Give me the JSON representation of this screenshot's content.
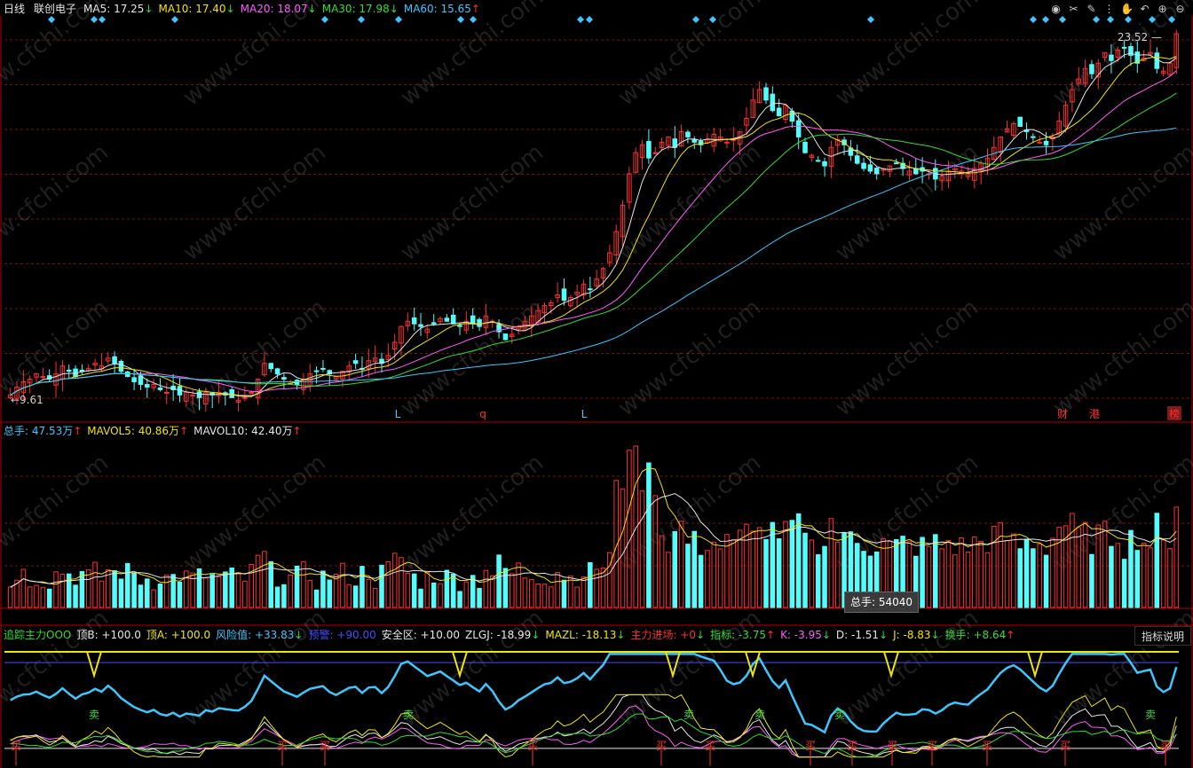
{
  "header": {
    "period": "日线",
    "stock_name": "联创电子",
    "ma": [
      {
        "label": "MA5: 17.25",
        "arrow": "↓",
        "color": "#e6e6e6"
      },
      {
        "label": "MA10: 17.40",
        "arrow": "↓",
        "color": "#f2e600"
      },
      {
        "label": "MA20: 18.07",
        "arrow": "↓",
        "color": "#ff5cff"
      },
      {
        "label": "MA30: 17.98",
        "arrow": "↓",
        "color": "#33dd33"
      },
      {
        "label": "MA60: 15.65",
        "arrow": "↑",
        "color": "#3cc8ff"
      }
    ]
  },
  "toolbar": {
    "icons": [
      "eye-icon",
      "scissors-icon",
      "draw-icon",
      "signal-icon",
      "hand-icon",
      "back-icon",
      "zoom-in-icon",
      "zoom-out-icon"
    ],
    "glyphs": [
      "◉",
      "✂",
      "✎",
      "⋮",
      "✋",
      "↶",
      "⊕",
      "⊖"
    ]
  },
  "price_panel": {
    "high_label": "23.52",
    "low_label": "9.61",
    "marks": [
      {
        "text": "L",
        "color": "#3cc8ff"
      },
      {
        "text": "q",
        "color": "#ff3030"
      },
      {
        "text": "L",
        "color": "#3cc8ff"
      },
      {
        "text": "财",
        "color": "#ff3030"
      },
      {
        "text": "港",
        "color": "#ff3030"
      },
      {
        "text": "榜",
        "color": "#ff3030"
      }
    ]
  },
  "volume_panel": {
    "legend": [
      {
        "label": "总手: 47.53万",
        "arrow": "↑",
        "color": "#3cc8ff"
      },
      {
        "label": "MAVOL5: 40.86万",
        "arrow": "↑",
        "color": "#f2e600"
      },
      {
        "label": "MAVOL10: 42.40万",
        "arrow": "↑",
        "color": "#e6e6e6"
      }
    ],
    "tooltip": "总手: 54040"
  },
  "indicator_panel": {
    "legend": [
      {
        "label": "追踪主力OOO",
        "color": "#33dd33"
      },
      {
        "label": "顶B: +100.0",
        "color": "#e6e6e6"
      },
      {
        "label": "顶A: +100.0",
        "color": "#f2e600"
      },
      {
        "label": "风险值: +33.83",
        "arrow": "↓",
        "color": "#3cc8ff"
      },
      {
        "label": "预警: +90.00",
        "color": "#4a4aff"
      },
      {
        "label": "安全区: +10.00",
        "color": "#e6e6e6"
      },
      {
        "label": "ZLGJ: -18.99",
        "arrow": "↓",
        "color": "#e6e6e6"
      },
      {
        "label": "MAZL: -18.13",
        "arrow": "↓",
        "color": "#f2e600"
      },
      {
        "label": "主力进场: +0",
        "arrow": "↓",
        "color": "#ff3030"
      },
      {
        "label": "指标: -3.75",
        "arrow": "↑",
        "color": "#33dd33"
      },
      {
        "label": "K: -3.95",
        "arrow": "↓",
        "color": "#ff5cff"
      },
      {
        "label": "D: -1.51",
        "arrow": "↓",
        "color": "#e6e6e6"
      },
      {
        "label": "J: -8.83",
        "arrow": "↓",
        "color": "#f2e600"
      },
      {
        "label": "换手: +8.64",
        "arrow": "↑",
        "color": "#33dd33"
      }
    ],
    "help_button": "指标说明",
    "buy_label": "买",
    "sell_label": "卖",
    "watermark": "www.cfchi.com"
  },
  "colors": {
    "up": "#ff3030",
    "down": "#54fcfc",
    "grid": "#7a1010",
    "border": "#b00000"
  },
  "chart_data": {
    "type": "candlestick",
    "period": "daily",
    "price_range": [
      9.61,
      23.52
    ],
    "volume_unit": "万手",
    "closes": [
      9.8,
      10.1,
      10.3,
      10.4,
      10.6,
      10.5,
      10.4,
      10.6,
      10.9,
      10.7,
      10.5,
      10.7,
      10.8,
      11.0,
      10.9,
      11.2,
      11.0,
      10.7,
      10.5,
      10.3,
      10.2,
      10.1,
      10.2,
      10.0,
      9.9,
      10.0,
      9.8,
      9.9,
      9.8,
      9.7,
      9.9,
      9.8,
      9.9,
      9.8,
      9.7,
      9.6,
      9.7,
      9.9,
      10.4,
      11.0,
      10.8,
      10.6,
      10.4,
      10.3,
      10.2,
      10.4,
      10.6,
      10.7,
      10.8,
      10.6,
      10.5,
      10.7,
      10.9,
      11.0,
      10.8,
      11.1,
      11.2,
      11.0,
      11.3,
      11.8,
      12.4,
      12.6,
      12.5,
      12.4,
      12.3,
      12.5,
      12.7,
      12.6,
      12.5,
      12.4,
      12.6,
      12.5,
      12.4,
      12.8,
      12.6,
      12.2,
      11.9,
      12.1,
      12.4,
      12.6,
      12.8,
      13.0,
      13.2,
      13.3,
      13.6,
      13.4,
      13.5,
      13.7,
      14.0,
      13.8,
      14.2,
      14.6,
      15.2,
      16.0,
      17.0,
      18.2,
      19.0,
      19.3,
      18.8,
      19.0,
      19.4,
      19.6,
      19.2,
      19.8,
      19.6,
      19.4,
      19.3,
      19.5,
      19.7,
      19.6,
      19.4,
      19.5,
      19.8,
      20.3,
      21.0,
      21.4,
      21.0,
      20.6,
      20.4,
      20.8,
      20.2,
      19.6,
      19.0,
      18.9,
      18.7,
      18.5,
      19.2,
      19.5,
      19.3,
      18.9,
      18.6,
      18.4,
      18.3,
      18.2,
      18.4,
      18.5,
      18.6,
      18.4,
      18.3,
      18.2,
      18.3,
      18.2,
      18.0,
      18.1,
      18.3,
      18.4,
      18.3,
      18.2,
      18.4,
      18.6,
      18.8,
      19.2,
      19.6,
      19.9,
      20.1,
      20.0,
      19.8,
      19.6,
      19.4,
      19.3,
      19.6,
      20.2,
      20.8,
      21.4,
      21.8,
      22.2,
      22.0,
      22.4,
      22.8,
      22.5,
      22.9,
      23.0,
      22.7,
      22.4,
      22.6,
      22.8,
      22.2,
      22.1,
      22.4,
      23.52
    ],
    "series": [
      {
        "name": "MA5",
        "current": 17.25
      },
      {
        "name": "MA10",
        "current": 17.4
      },
      {
        "name": "MA20",
        "current": 18.07
      },
      {
        "name": "MA30",
        "current": 17.98
      },
      {
        "name": "MA60",
        "current": 15.65
      },
      {
        "name": "总手",
        "current": 47.53
      },
      {
        "name": "MAVOL5",
        "current": 40.86
      },
      {
        "name": "MAVOL10",
        "current": 42.4
      }
    ]
  }
}
